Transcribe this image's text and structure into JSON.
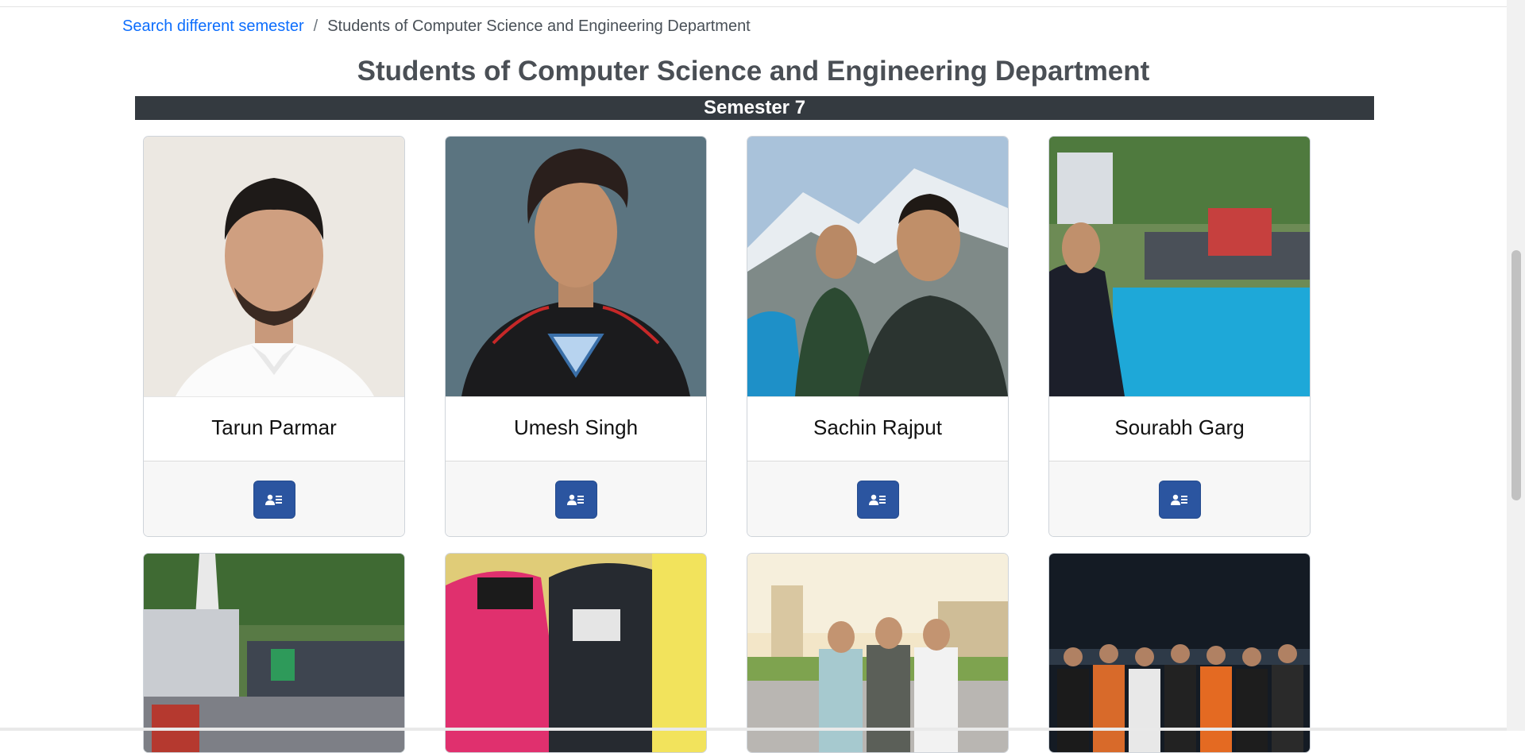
{
  "breadcrumb": {
    "link_label": "Search different semester",
    "separator": "/",
    "current": "Students of Computer Science and Engineering Department"
  },
  "page_title": "Students of Computer Science and Engineering Department",
  "semester_label": "Semester 7",
  "students": [
    {
      "name": "Tarun Parmar",
      "icon": "profile-card-icon"
    },
    {
      "name": "Umesh Singh",
      "icon": "profile-card-icon"
    },
    {
      "name": "Sachin Rajput",
      "icon": "profile-card-icon"
    },
    {
      "name": "Sourabh Garg",
      "icon": "profile-card-icon"
    }
  ],
  "colors": {
    "link": "#0d6efd",
    "semester_bar": "#343a40",
    "profile_button": "#2b55a0"
  }
}
